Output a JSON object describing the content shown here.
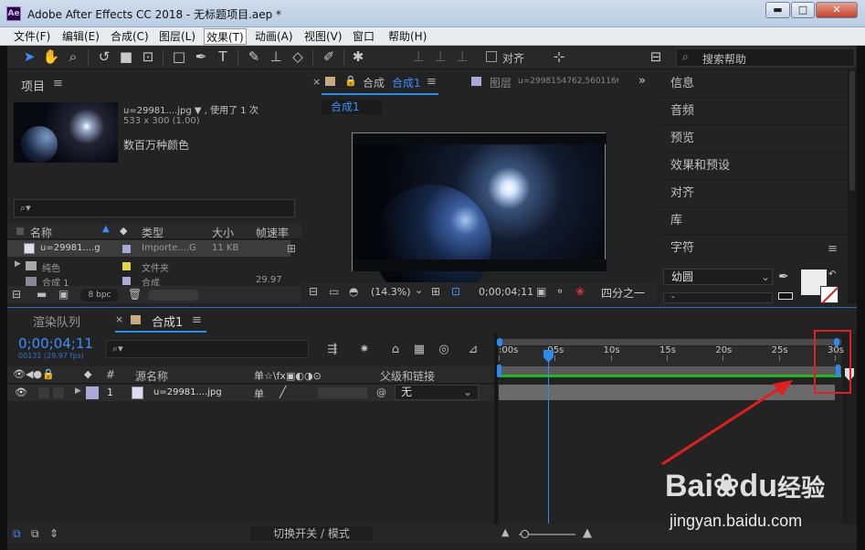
{
  "window": {
    "app_title": "Adobe After Effects CC 2018 - 无标题项目.aep *",
    "logo_text": "Ae",
    "min_label": "▬",
    "max_label": "□",
    "close_label": "✕"
  },
  "menu": [
    "文件(F)",
    "编辑(E)",
    "合成(C)",
    "图层(L)",
    "效果(T)",
    "动画(A)",
    "视图(V)",
    "窗口",
    "帮助(H)"
  ],
  "toolbar": {
    "snap_label": "对齐",
    "search_placeholder": "搜索帮助"
  },
  "project": {
    "title": "项目",
    "item_name": "u=29981....jpg ▼ , 使用了 1 次",
    "item_size": "533 x 300 (1.00)",
    "item_color": "数百万种颜色",
    "search_icon": "⌕▾",
    "columns": {
      "name": "名称",
      "type": "类型",
      "size": "大小",
      "fps": "帧速率"
    },
    "rows": [
      {
        "name": "u=29981....g",
        "type": "Importe....G",
        "size": "11 KB",
        "fps": ""
      },
      {
        "name": "纯色",
        "type": "文件夹",
        "size": "",
        "fps": ""
      },
      {
        "name": "合成 1",
        "type": "合成",
        "size": "",
        "fps": "29.97"
      }
    ],
    "bpc": "8 bpc"
  },
  "composition": {
    "tab_comp_prefix": "合成",
    "tab_comp_name": "合成1",
    "tab_layer_prefix": "图层",
    "tab_layer_name": "u=2998154762,5601166",
    "breadcrumb": "合成1",
    "zoom": "(14.3%)",
    "timecode": "0;00;04;11",
    "view": "四分之一"
  },
  "right_panel": {
    "items": [
      "信息",
      "音频",
      "预览",
      "效果和预设",
      "对齐",
      "库"
    ],
    "char_title": "字符",
    "font": "幼圆",
    "font_style": "-"
  },
  "timeline": {
    "tab_render": "渲染队列",
    "tab_comp": "合成1",
    "timecode": "0;00;04;11",
    "subcode": "00131 (29.97 fps)",
    "search_icon": "⌕▾",
    "col_source": "源名称",
    "col_switches": "单☆\\fx▣◐◑⊙",
    "col_parent": "父级和链接",
    "col_num": "#",
    "layer": {
      "num": "1",
      "name": "u=29981....jpg",
      "switch": "单",
      "parent": "无",
      "spiral": "@"
    },
    "ruler": [
      ":00s",
      "05s",
      "10s",
      "15s",
      "20s",
      "25s",
      "30s"
    ],
    "playhead_seconds": 4.4,
    "duration_seconds": 30,
    "footer": "切换开关 / 模式"
  },
  "watermark": {
    "brand": "Bai",
    "brand2": "du",
    "cn": "经验",
    "url": "jingyan.baidu.com"
  },
  "colors": {
    "accent": "#2d8ceb",
    "annot": "#e02020",
    "layer_label": "#aaaad8",
    "timeline_bar": "#6a6a6a",
    "work_area": "#22b422"
  }
}
